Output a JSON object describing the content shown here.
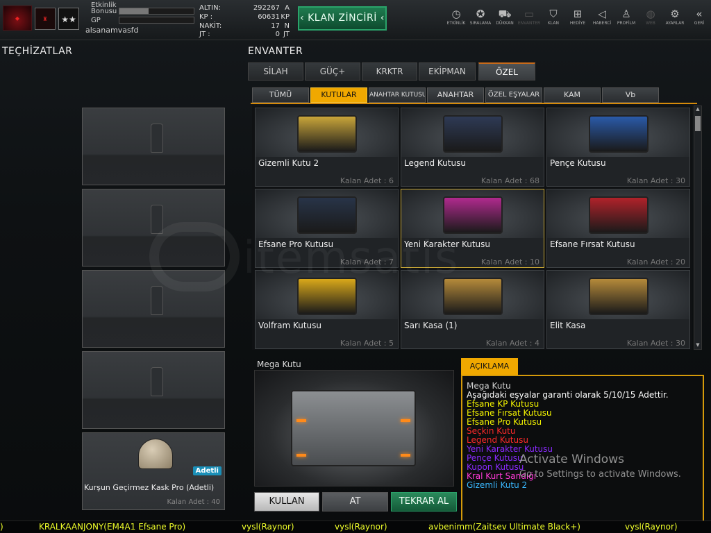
{
  "topbar": {
    "bonus_label": "Etkinlik\nBonusu",
    "gp_label": "GP",
    "username": "alsanamvasfd",
    "bonus_fill": 0.39,
    "gp_fill": 0.0,
    "currencies": [
      {
        "key": "ALTIN:",
        "value": "292267",
        "unit": "A"
      },
      {
        "key": "KP :",
        "value": "60631",
        "unit": "KP"
      },
      {
        "key": "NAKİT:",
        "value": "17",
        "unit": "N"
      },
      {
        "key": "JT :",
        "value": "0",
        "unit": "JT"
      }
    ],
    "clan_button": "‹ KLAN ZİNCİRİ ‹",
    "nav": [
      {
        "label": "ETKİNLİK",
        "icon": "stopwatch-icon",
        "glyph": "◷"
      },
      {
        "label": "SIRALAMA",
        "icon": "medal-icon",
        "glyph": "✪"
      },
      {
        "label": "DÜKKAN",
        "icon": "cart-icon",
        "glyph": "⛟"
      },
      {
        "label": "ENVANTER",
        "icon": "inventory-icon",
        "glyph": "▭"
      },
      {
        "label": "KLAN",
        "icon": "shield-icon",
        "glyph": "⛉"
      },
      {
        "label": "HEDİYE",
        "icon": "gift-icon",
        "glyph": "⊞"
      },
      {
        "label": "HABERCİ",
        "icon": "megaphone-icon",
        "glyph": "◁"
      },
      {
        "label": "PROFİLM",
        "icon": "profile-icon",
        "glyph": "♙"
      },
      {
        "label": "WEB",
        "icon": "globe-icon",
        "glyph": "◍"
      },
      {
        "label": "AYARLAR",
        "icon": "gear-icon",
        "glyph": "⚙"
      },
      {
        "label": "GERİ",
        "icon": "back-icon",
        "glyph": "«"
      }
    ]
  },
  "left": {
    "title": "TEÇHİZATLAR",
    "equipped": {
      "name": "Kurşun Geçirmez Kask Pro (Adetli)",
      "badge": "Adetli",
      "count": "Kalan Adet : 40"
    }
  },
  "inventory": {
    "title": "ENVANTER",
    "tabs": [
      "SİLAH",
      "GÜÇ+",
      "KRKTR",
      "EKİPMAN",
      "ÖZEL"
    ],
    "subtabs": [
      "TÜMÜ",
      "KUTULAR",
      "ANAHTAR KUTUSU",
      "ANAHTAR",
      "ÖZEL EŞYALAR",
      "KAM",
      "Vb"
    ],
    "items": [
      {
        "name": "Gizemli Kutu 2",
        "count": "Kalan Adet : 6",
        "color": "#c9a53a"
      },
      {
        "name": "Legend Kutusu",
        "count": "Kalan Adet : 68",
        "color": "#2e3a55"
      },
      {
        "name": "Pençe Kutusu",
        "count": "Kalan Adet : 30",
        "color": "#2a5aa8"
      },
      {
        "name": "Efsane Pro Kutusu",
        "count": "Kalan Adet : 7",
        "color": "#283448"
      },
      {
        "name": "Yeni Karakter Kutusu",
        "count": "Kalan Adet : 10",
        "color": "#b02a8e"
      },
      {
        "name": "Efsane Fırsat Kutusu",
        "count": "Kalan Adet : 20",
        "color": "#b0222a"
      },
      {
        "name": "Volfram Kutusu",
        "count": "Kalan Adet : 5",
        "color": "#d9a81a"
      },
      {
        "name": "Sarı Kasa (1)",
        "count": "Kalan Adet : 4",
        "color": "#b58a3a"
      },
      {
        "name": "Elit Kasa",
        "count": "Kalan Adet : 30",
        "color": "#b58a3a"
      }
    ]
  },
  "detail": {
    "title": "Mega Kutu",
    "buttons": {
      "use": "KULLAN",
      "drop": "AT",
      "again": "TEKRAR AL"
    },
    "desc_tab": "AÇIKLAMA",
    "lines": [
      {
        "text": "Mega Kutu",
        "color": "#cfcfcf"
      },
      {
        "text": "Aşağıdaki eşyalar garanti olarak 5/10/15 Adettir.",
        "color": "#ffffff"
      },
      {
        "text": "Efsane KP Kutusu",
        "color": "#f4f400"
      },
      {
        "text": "Efsane Fırsat Kutusu",
        "color": "#f4f400"
      },
      {
        "text": "Efsane Pro Kutusu",
        "color": "#f4f400"
      },
      {
        "text": "Seçkin Kutu",
        "color": "#ff2a2a"
      },
      {
        "text": "Legend Kutusu",
        "color": "#ff2a2a"
      },
      {
        "text": "Yeni Karakter Kutusu",
        "color": "#8a2aff"
      },
      {
        "text": "Pençe Kutusu",
        "color": "#8a2aff"
      },
      {
        "text": "Kupon Kutusu",
        "color": "#8a2aff"
      },
      {
        "text": "Kral Kurt Sandığı",
        "color": "#ff3ad8"
      },
      {
        "text": "Gizemli Kutu 2",
        "color": "#3ab8ff"
      }
    ]
  },
  "overlay": {
    "activate_title": "Activate Windows",
    "activate_sub": "Go to Settings to activate Windows."
  },
  "ticker": [
    ")",
    "KRALKAANJONY(EM4A1 Efsane Pro)",
    "vysl(Raynor)",
    "vysl(Raynor)",
    "avbenimm(Zaitsev Ultimate Black+)",
    "vysl(Raynor)"
  ]
}
